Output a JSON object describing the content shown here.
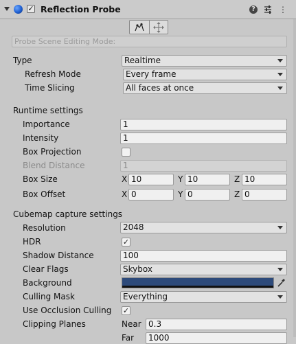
{
  "header": {
    "title": "Reflection Probe",
    "enabled": true,
    "help_icon": "help-icon",
    "presets_icon": "presets-icon",
    "menu_icon": "more-options-icon"
  },
  "toolbar": {
    "edit_icon": "edit-bounds-icon",
    "move_icon": "move-icon"
  },
  "scene_mode": {
    "placeholder": "Probe Scene Editing Mode:"
  },
  "type": {
    "label": "Type",
    "value": "Realtime",
    "refresh_mode_label": "Refresh Mode",
    "refresh_mode_value": "Every frame",
    "time_slicing_label": "Time Slicing",
    "time_slicing_value": "All faces at once"
  },
  "runtime": {
    "section_label": "Runtime settings",
    "importance_label": "Importance",
    "importance_value": "1",
    "intensity_label": "Intensity",
    "intensity_value": "1",
    "box_projection_label": "Box Projection",
    "box_projection_checked": false,
    "blend_distance_label": "Blend Distance",
    "blend_distance_value": "1",
    "box_size_label": "Box Size",
    "box_size": {
      "x_label": "X",
      "x": "10",
      "y_label": "Y",
      "y": "10",
      "z_label": "Z",
      "z": "10"
    },
    "box_offset_label": "Box Offset",
    "box_offset": {
      "x_label": "X",
      "x": "0",
      "y_label": "Y",
      "y": "0",
      "z_label": "Z",
      "z": "0"
    }
  },
  "cubemap": {
    "section_label": "Cubemap capture settings",
    "resolution_label": "Resolution",
    "resolution_value": "2048",
    "hdr_label": "HDR",
    "hdr_checked": true,
    "shadow_distance_label": "Shadow Distance",
    "shadow_distance_value": "100",
    "clear_flags_label": "Clear Flags",
    "clear_flags_value": "Skybox",
    "background_label": "Background",
    "background_color": "#2d4a7a",
    "culling_mask_label": "Culling Mask",
    "culling_mask_value": "Everything",
    "occlusion_label": "Use Occlusion Culling",
    "occlusion_checked": true,
    "clipping_label": "Clipping Planes",
    "near_label": "Near",
    "near_value": "0.3",
    "far_label": "Far",
    "far_value": "1000"
  }
}
